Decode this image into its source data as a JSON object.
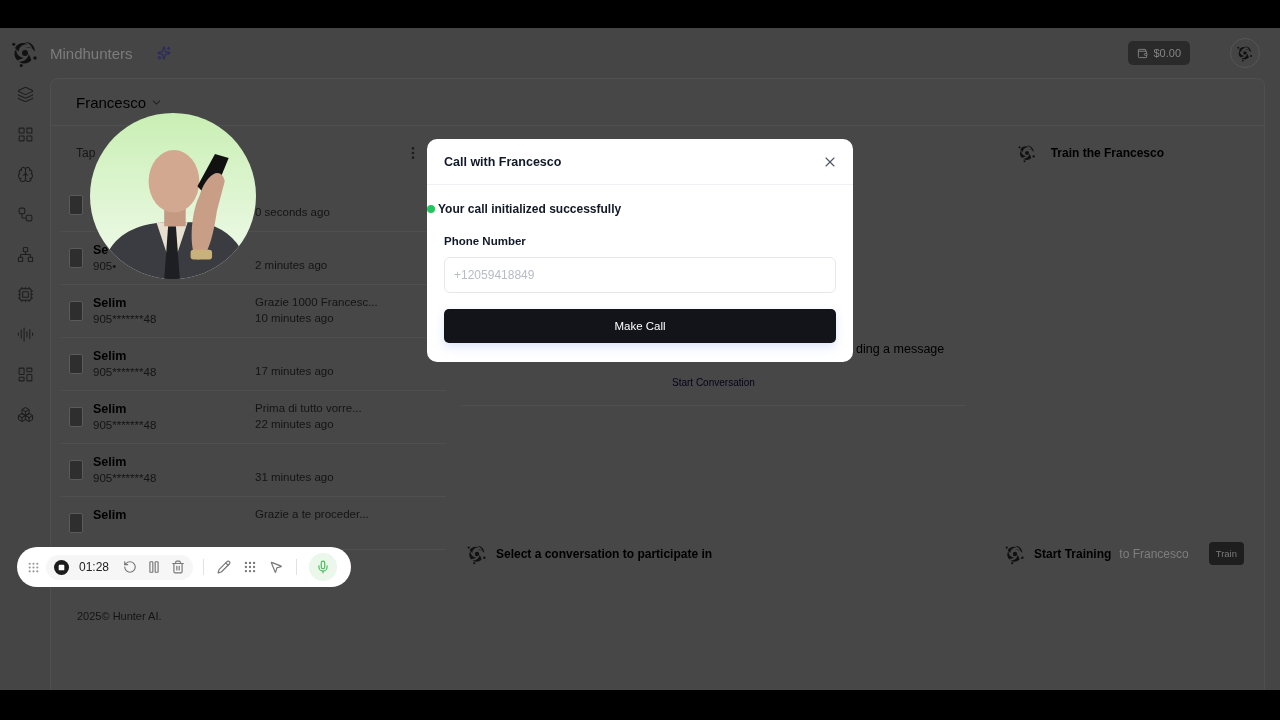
{
  "brand": {
    "name": "Mindhunters"
  },
  "balance": "$0.00",
  "agent": {
    "name": "Francesco"
  },
  "list": {
    "search_placeholder": "Tap",
    "conversations": [
      {
        "time": "0 seconds ago"
      },
      {
        "name": "Se",
        "phone": "905•",
        "time": "2 minutes ago"
      },
      {
        "name": "Selim",
        "phone": "905*******48",
        "preview": "Grazie 1000 Francesc...",
        "time": "10 minutes ago"
      },
      {
        "name": "Selim",
        "phone": "905*******48",
        "time": "17 minutes ago"
      },
      {
        "name": "Selim",
        "phone": "905*******48",
        "preview": "Prima di tutto vorre...",
        "time": "22 minutes ago"
      },
      {
        "name": "Selim",
        "phone": "905*******48",
        "time": "31 minutes ago"
      },
      {
        "name": "Selim",
        "preview": "Grazie a te proceder..."
      }
    ]
  },
  "footer": "2025©  Hunter AI.",
  "chat": {
    "header": "Train the Francesco",
    "empty_message": "ding a message",
    "start_link": "Start Conversation",
    "select_prompt": "Select a conversation to participate in",
    "training_title": "Start Training",
    "training_target": "to Francesco",
    "train_button": "Train"
  },
  "modal": {
    "title": "Call with Francesco",
    "status": "Your call initialized successfully",
    "field_label": "Phone Number",
    "placeholder": "+12059418849",
    "button": "Make Call"
  },
  "recorder": {
    "time": "01:28",
    "mic_on": true
  }
}
